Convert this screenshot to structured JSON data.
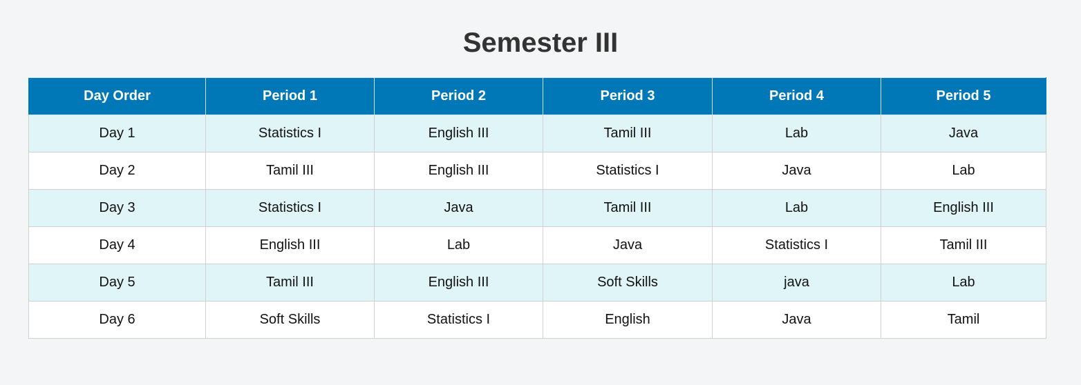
{
  "title": "Semester III",
  "timetable": {
    "headers": [
      "Day Order",
      "Period 1",
      "Period 2",
      "Period 3",
      "Period 4",
      "Period 5"
    ],
    "rows": [
      [
        "Day 1",
        "Statistics I",
        "English III",
        "Tamil III",
        "Lab",
        "Java"
      ],
      [
        "Day 2",
        "Tamil III",
        "English III",
        "Statistics I",
        "Java",
        "Lab"
      ],
      [
        "Day 3",
        "Statistics I",
        "Java",
        "Tamil III",
        "Lab",
        "English III"
      ],
      [
        "Day 4",
        "English III",
        "Lab",
        "Java",
        "Statistics I",
        "Tamil III"
      ],
      [
        "Day 5",
        "Tamil III",
        "English III",
        "Soft Skills",
        "java",
        "Lab"
      ],
      [
        "Day 6",
        "Soft Skills",
        "Statistics I",
        "English",
        "Java",
        "Tamil"
      ]
    ]
  },
  "colors": {
    "header_bg": "#0077b6",
    "header_text": "#ffffff",
    "row_alt_bg": "#e0f5f8",
    "row_bg": "#ffffff",
    "page_bg": "#f4f5f7",
    "title_color": "#333333"
  }
}
